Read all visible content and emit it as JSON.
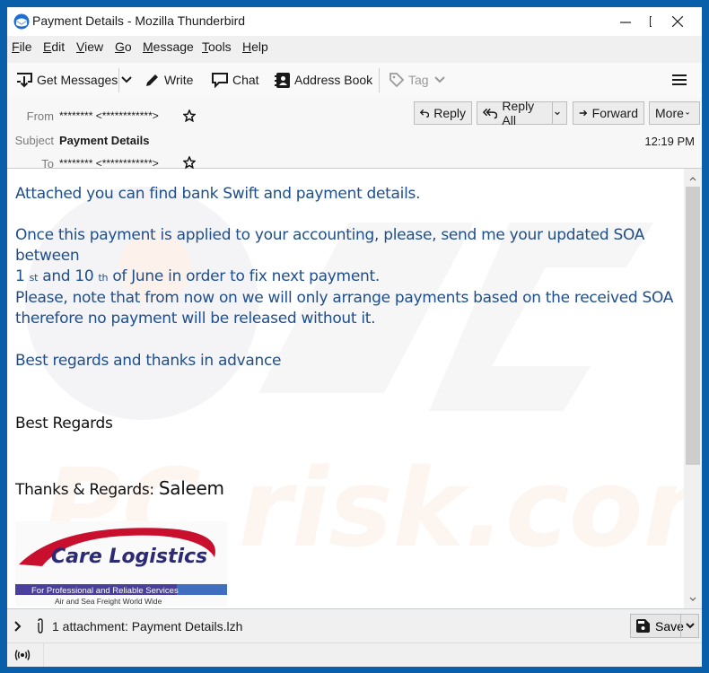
{
  "window": {
    "title": "Payment Details - Mozilla Thunderbird",
    "controls": {
      "minimize": "minimize-icon",
      "maximize": "maximize-icon",
      "close": "close-icon"
    }
  },
  "menubar": {
    "items": [
      {
        "label": "File",
        "accel": "F",
        "rest": "ile"
      },
      {
        "label": "Edit",
        "accel": "E",
        "rest": "dit"
      },
      {
        "label": "View",
        "accel": "V",
        "rest": "iew"
      },
      {
        "label": "Go",
        "accel": "G",
        "rest": "o"
      },
      {
        "label": "Message",
        "accel": "M",
        "rest": "essage"
      },
      {
        "label": "Tools",
        "accel": "T",
        "rest": "ools"
      },
      {
        "label": "Help",
        "accel": "H",
        "rest": "elp"
      }
    ]
  },
  "toolbar": {
    "get_messages": "Get Messages",
    "write": "Write",
    "chat": "Chat",
    "address_book": "Address Book",
    "tag": "Tag"
  },
  "header": {
    "from_label": "From",
    "from_value": "******** <************>",
    "subject_label": "Subject",
    "subject_value": "Payment Details",
    "to_label": "To",
    "to_value": "******** <************>",
    "time": "12:19 PM",
    "buttons": {
      "reply": "Reply",
      "reply_all": "Reply All",
      "forward": "Forward",
      "more": "More"
    }
  },
  "message": {
    "p1": "Attached you can find bank Swift and payment details.",
    "p2_line1": "Once this payment is applied to your accounting, please, send me your updated SOA between",
    "p2_line2_a": "1",
    "p2_line2_sup1": "st",
    "p2_line2_b": "and 10",
    "p2_line2_sup2": "th",
    "p2_line2_c": "of June in order to fix next payment.",
    "p3_line1": "Please, note that from now on we will only arrange payments based on the received SOA",
    "p3_line2": "therefore no payment will be released without it.",
    "p4": "Best regards and thanks in advance",
    "sig1": "Best Regards",
    "sig2_prefix": "Thanks & Regards: ",
    "sig2_name": "Saleem",
    "logo": {
      "company": "Care Logistics",
      "tagline": "For Professional and Reliable Services",
      "subtagline": "Air and Sea Freight World Wide"
    },
    "watermark": "PC risk.com"
  },
  "attachments": {
    "summary": "1 attachment: Payment Details.lzh",
    "save_label": "Save"
  },
  "colors": {
    "desktop_accent": "#0a5fab",
    "message_text": "#1f4e8c",
    "logo_red": "#c8102e",
    "logo_navy": "#2b2a73",
    "logo_bar": "#4a3f9a"
  }
}
